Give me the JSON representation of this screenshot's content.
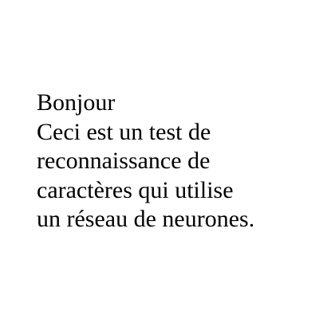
{
  "document": {
    "lines": [
      "Bonjour",
      "Ceci est un test de",
      "reconnaissance de",
      "caractères qui utilise",
      "un réseau de neurones."
    ]
  },
  "colors": {
    "background": "#ffffff",
    "text": "#000000"
  }
}
